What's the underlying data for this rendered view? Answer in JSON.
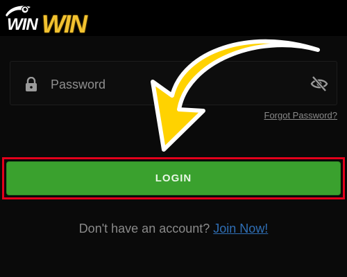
{
  "header": {
    "logo_text_left": "WIN",
    "logo_text_right": "WIN"
  },
  "login_form": {
    "password_placeholder": "Password",
    "password_value": "",
    "forgot_password_label": "Forgot Password?",
    "login_button_label": "LOGIN",
    "signup_prompt": "Don't have an account?",
    "join_now_label": "Join Now!"
  },
  "icons": {
    "password_prefix": "lock-icon",
    "password_suffix": "eye-off-icon",
    "annotation": "arrow-icon"
  },
  "colors": {
    "background": "#0a0a0a",
    "login_button": "#3aa12e",
    "highlight_frame": "#e3001b",
    "arrow_fill": "#ffd200",
    "logo_accent": "#f2c230",
    "link": "#2f6fb6"
  }
}
